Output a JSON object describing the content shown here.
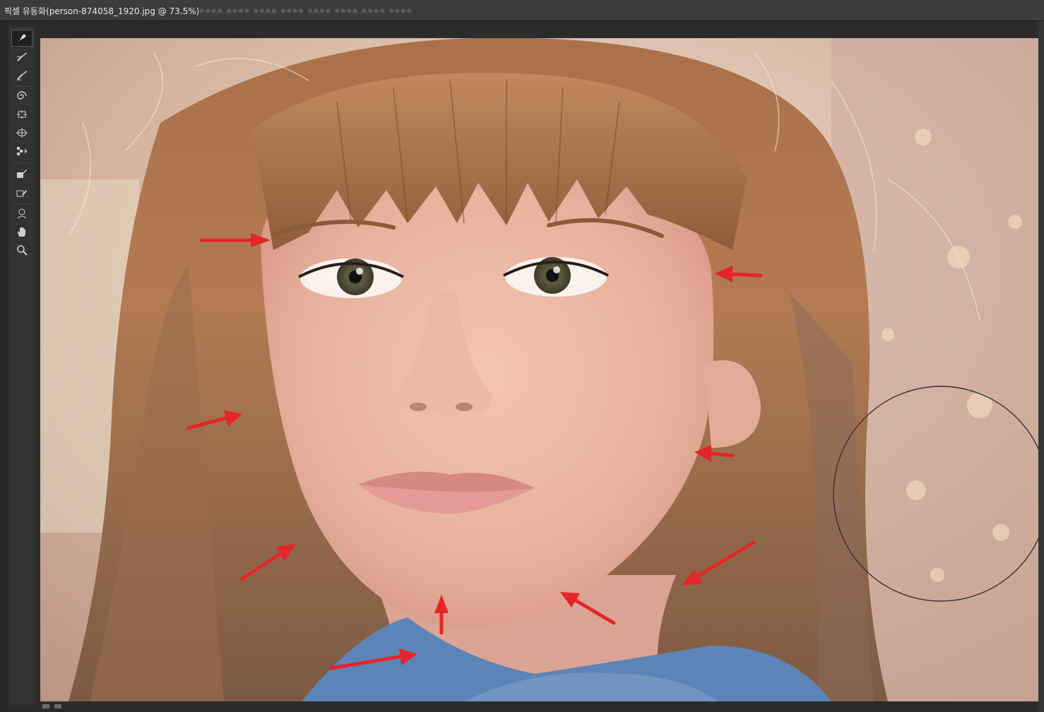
{
  "window": {
    "title": "픽셀 유동화(person-874058_1920.jpg @ 73.5%)"
  },
  "tools": [
    {
      "id": "forward-warp",
      "icon": "forward-warp-icon",
      "active": true
    },
    {
      "id": "reconstruct",
      "icon": "reconstruct-brush-icon"
    },
    {
      "id": "smooth",
      "icon": "smooth-brush-icon"
    },
    {
      "id": "twirl",
      "icon": "twirl-clockwise-icon"
    },
    {
      "id": "pucker",
      "icon": "pucker-icon"
    },
    {
      "id": "bloat",
      "icon": "bloat-icon"
    },
    {
      "id": "push-left",
      "icon": "push-left-icon"
    },
    {
      "id": "freeze-mask",
      "icon": "freeze-mask-icon"
    },
    {
      "id": "thaw-mask",
      "icon": "thaw-mask-icon"
    },
    {
      "id": "face",
      "icon": "face-tool-icon"
    },
    {
      "id": "hand",
      "icon": "hand-icon"
    },
    {
      "id": "zoom",
      "icon": "zoom-icon"
    }
  ],
  "colors": {
    "arrow": "#e5252a",
    "panel": "#323232",
    "titlebar": "#3c3c3c"
  }
}
